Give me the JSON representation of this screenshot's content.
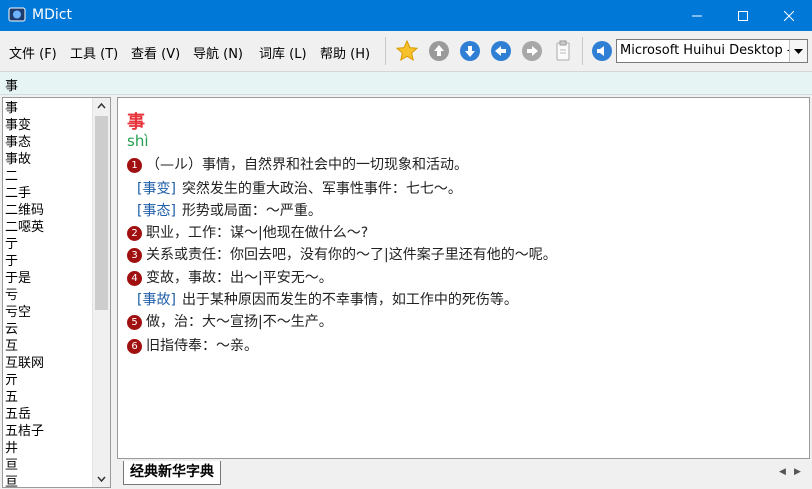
{
  "window": {
    "title": "MDict"
  },
  "menu": {
    "items": [
      "文件 (F)",
      "工具 (T)",
      "查看 (V)",
      "导航 (N)",
      "词库 (L)",
      "帮助 (H)"
    ]
  },
  "toolbar": {
    "icons": [
      "star-icon",
      "arrow-up-icon",
      "arrow-down-icon",
      "arrow-left-icon",
      "arrow-right-icon",
      "clipboard-icon",
      "speaker-icon"
    ],
    "dictionary_selected": "Microsoft Huihui Desktop -"
  },
  "search": {
    "value": "事"
  },
  "wordlist": {
    "items": [
      "事",
      "事变",
      "事态",
      "事故",
      "二",
      "二手",
      "二维码",
      "二噁英",
      "亍",
      "于",
      "于是",
      "亏",
      "亏空",
      "云",
      "互",
      "互联网",
      "亓",
      "五",
      "五岳",
      "五桔子",
      "井",
      "亘",
      "亘"
    ]
  },
  "entry": {
    "headword": "事",
    "pinyin": "shì",
    "senses": [
      {
        "num": "1",
        "text": "（—ル）事情，自然界和社会中的一切现象和活动。"
      },
      {
        "tag": "[事变]",
        "text": "突然发生的重大政治、军事性事件：七七～。"
      },
      {
        "tag": "[事态]",
        "text": "形势或局面：～严重。"
      },
      {
        "num": "2",
        "text": "职业，工作：谋～|他现在做什么～?"
      },
      {
        "num": "3",
        "text": "关系或责任：你回去吧，没有你的～了|这件案子里还有他的～呢。"
      },
      {
        "num": "4",
        "text": "变故，事故：出～|平安无～。"
      },
      {
        "tag": "[事故]",
        "text": "出于某种原因而发生的不幸事情，如工作中的死伤等。"
      },
      {
        "num": "5",
        "text": "做，治：大～宣扬|不～生产。"
      },
      {
        "num": "6",
        "text": "旧指侍奉：～亲。"
      }
    ]
  },
  "tabs": {
    "active": "经典新华字典"
  },
  "colors": {
    "titlebar": "#0078d7",
    "headword": "#e8333a",
    "pinyin": "#26a050",
    "tag": "#1f5ea8",
    "sense_number": "#a01010"
  }
}
